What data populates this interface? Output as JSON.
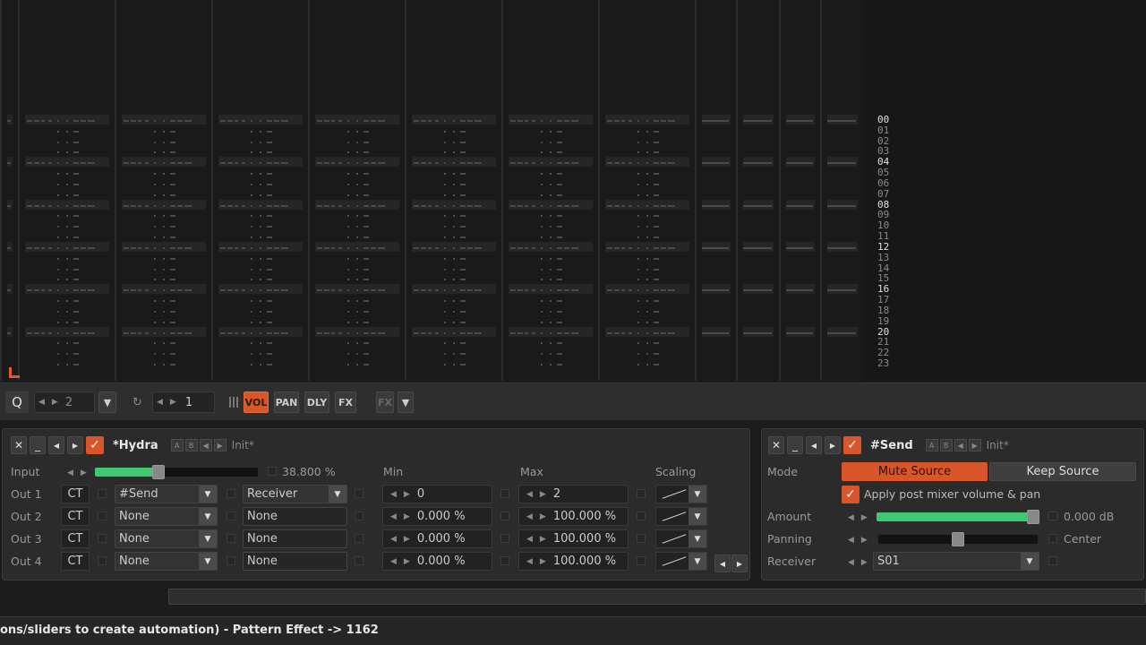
{
  "pattern": {
    "row_numbers": [
      "00",
      "01",
      "02",
      "03",
      "04",
      "05",
      "06",
      "07",
      "08",
      "09",
      "10",
      "11",
      "12",
      "13",
      "14",
      "15",
      "16",
      "17",
      "18",
      "19",
      "20",
      "21",
      "22",
      "23"
    ],
    "highlight_rows": [
      "00",
      "04",
      "08",
      "12",
      "16",
      "20"
    ]
  },
  "toolbar": {
    "q_label": "Q",
    "edit_step": "2",
    "pattern_follow_value": "1",
    "vol_label": "VOL",
    "pan_label": "PAN",
    "dly_label": "DLY",
    "fx_label": "FX",
    "fx_menu_label": "FX"
  },
  "hydra": {
    "title": "*Hydra",
    "a_label": "A",
    "b_label": "B",
    "preset": "Init*",
    "input_label": "Input",
    "input_value": "38.800 %",
    "input_level_percent": 38.8,
    "col_min": "Min",
    "col_max": "Max",
    "col_scaling": "Scaling",
    "outs": [
      {
        "label": "Out 1",
        "ct": "CT",
        "device": "#Send",
        "param": "Receiver",
        "min": "0",
        "max": "2"
      },
      {
        "label": "Out 2",
        "ct": "CT",
        "device": "None",
        "param": "None",
        "min": "0.000 %",
        "max": "100.000 %"
      },
      {
        "label": "Out 3",
        "ct": "CT",
        "device": "None",
        "param": "None",
        "min": "0.000 %",
        "max": "100.000 %"
      },
      {
        "label": "Out 4",
        "ct": "CT",
        "device": "None",
        "param": "None",
        "min": "0.000 %",
        "max": "100.000 %"
      }
    ]
  },
  "send": {
    "title": "#Send",
    "a_label": "A",
    "b_label": "B",
    "preset": "Init*",
    "mode_label": "Mode",
    "mute_source": "Mute Source",
    "keep_source": "Keep Source",
    "apply_post": "Apply post mixer volume & pan",
    "amount_label": "Amount",
    "amount_value": "0.000 dB",
    "amount_level_percent": 100,
    "panning_label": "Panning",
    "panning_value": "Center",
    "panning_position_percent": 50,
    "receiver_label": "Receiver",
    "receiver_value": "S01"
  },
  "status": {
    "text": "ons/sliders to create automation) - Pattern Effect -> 1162"
  },
  "colors": {
    "accent": "#d9562a",
    "slider_fill": "#3fc872"
  }
}
